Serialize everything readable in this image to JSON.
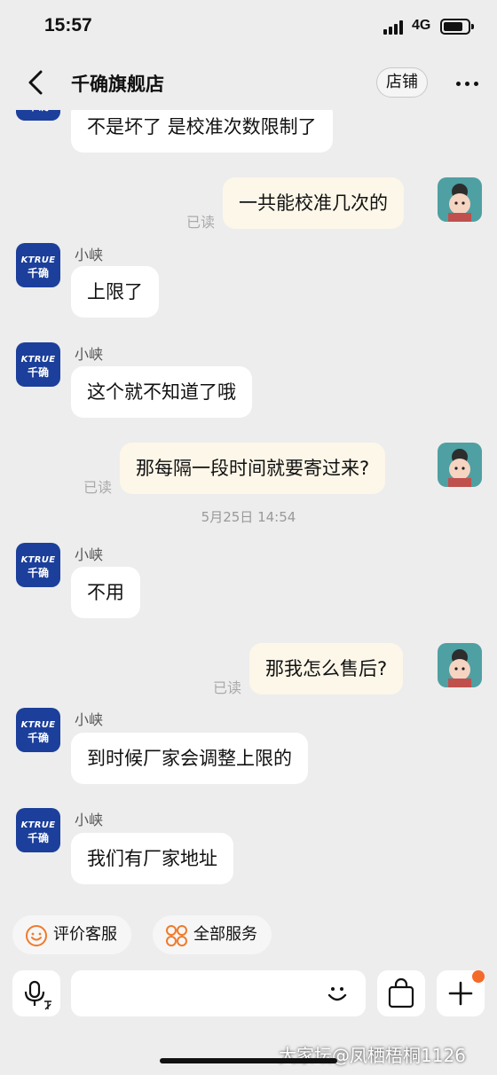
{
  "status_bar": {
    "time": "15:57",
    "network": "4G"
  },
  "nav": {
    "title": "千确旗舰店",
    "shop_button": "店铺"
  },
  "shop_avatar": {
    "brand_en": "KTRUE",
    "brand_cn": "千确"
  },
  "messages": [
    {
      "side": "in",
      "text": "不是坏了 是校准次数限制了"
    },
    {
      "side": "out",
      "text": "一共能校准几次的",
      "status": "已读"
    },
    {
      "side": "in",
      "sender": "小峡",
      "text": "上限了"
    },
    {
      "side": "in",
      "sender": "小峡",
      "text": "这个就不知道了哦"
    },
    {
      "side": "out",
      "text": "那每隔一段时间就要寄过来?",
      "status": "已读"
    },
    {
      "side": "time",
      "text": "5月25日 14:54"
    },
    {
      "side": "in",
      "sender": "小峡",
      "text": "不用"
    },
    {
      "side": "out",
      "text": "那我怎么售后?",
      "status": "已读"
    },
    {
      "side": "in",
      "sender": "小峡",
      "text": "到时候厂家会调整上限的"
    },
    {
      "side": "in",
      "sender": "小峡",
      "text": "我们有厂家地址"
    }
  ],
  "quick_actions": {
    "rate_service": "评价客服",
    "all_services": "全部服务"
  },
  "input": {
    "value": "",
    "placeholder": ""
  },
  "colors": {
    "shop_avatar_bg": "#1b3f9b",
    "outgoing_bubble": "#fdf7e9",
    "notification_dot": "#f46a2a",
    "rate_icon": "#f07a2a"
  },
  "watermark": "大家坛@凤栖梧桐1126"
}
